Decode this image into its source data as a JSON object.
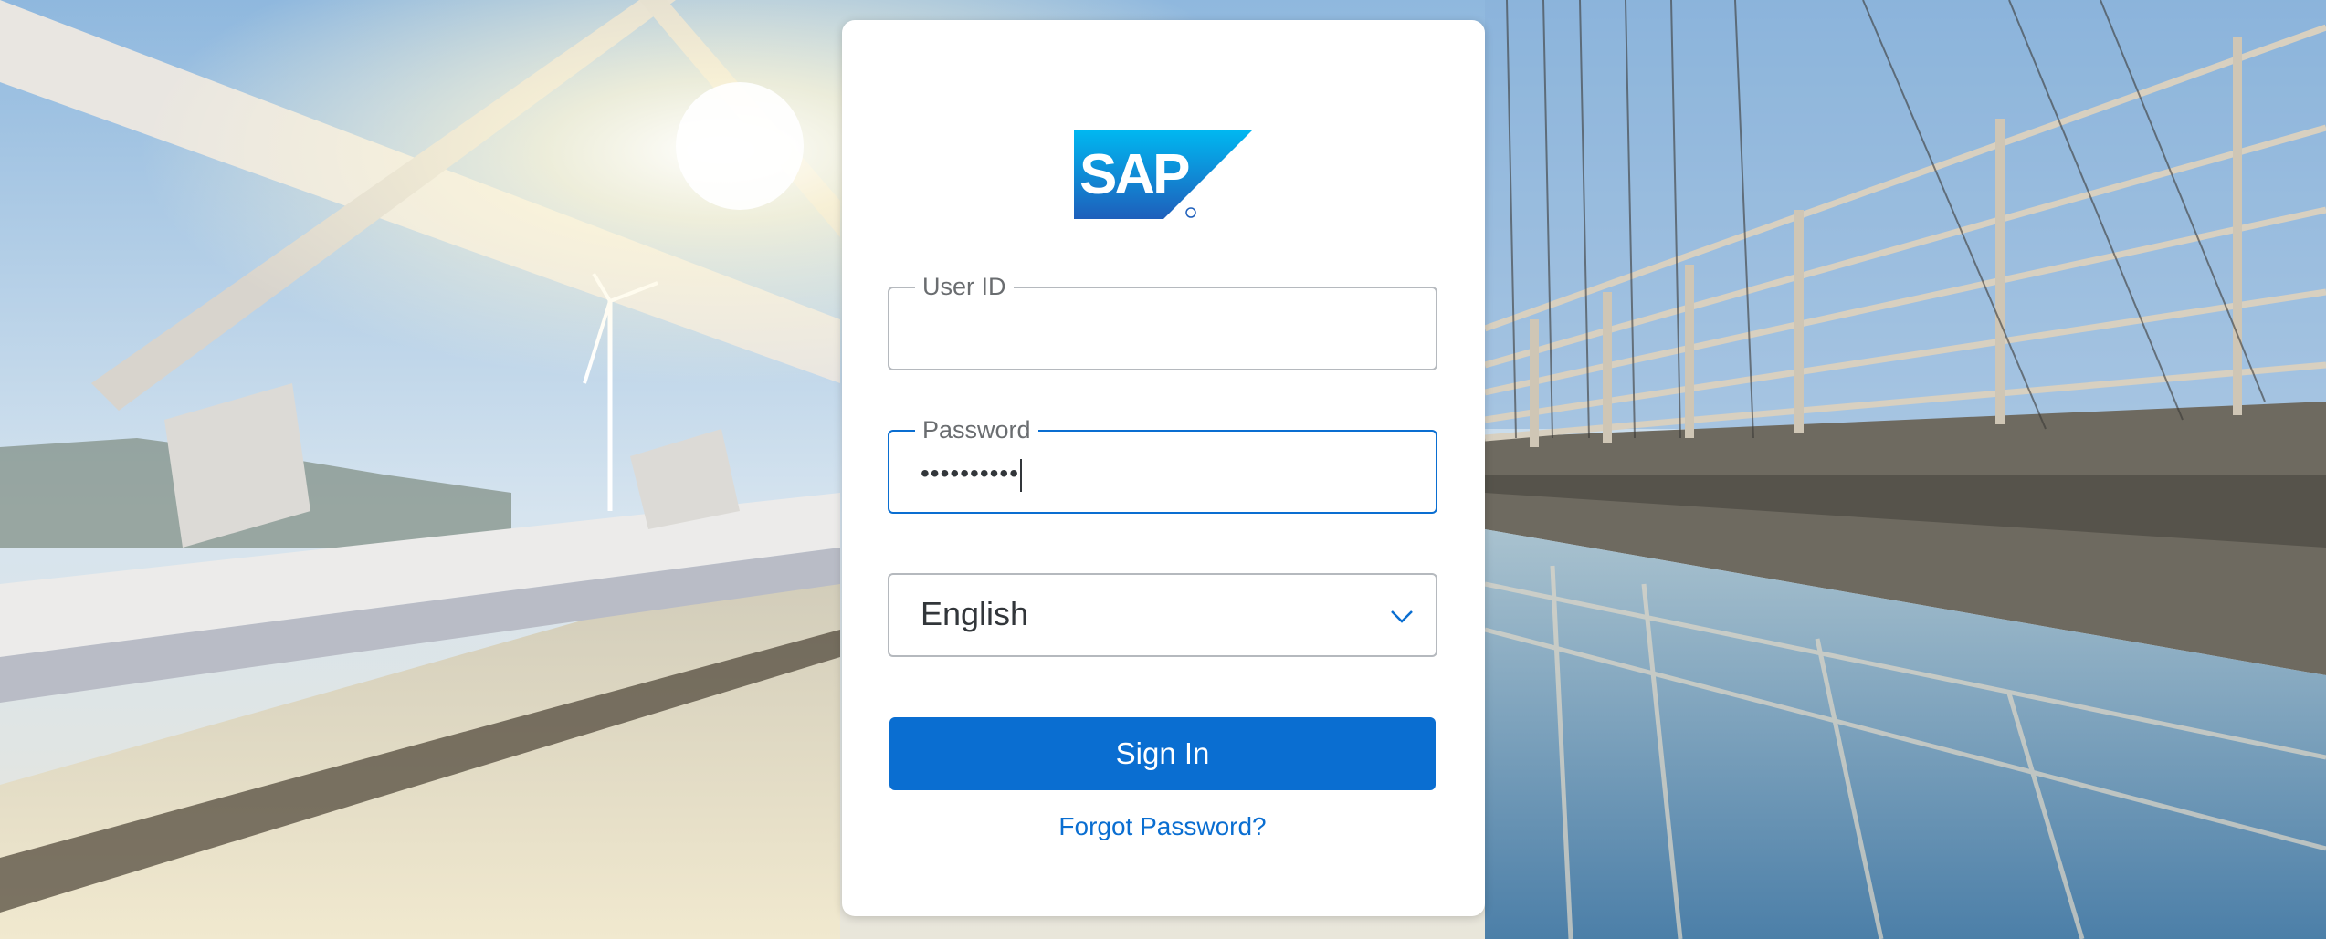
{
  "brand": {
    "logo_text": "SAP",
    "primary_color": "#0a6ed1"
  },
  "login": {
    "user_id": {
      "label": "User ID",
      "value": ""
    },
    "password": {
      "label": "Password",
      "masked_value": "••••••••••"
    },
    "language": {
      "selected": "English",
      "icon": "chevron-down-icon"
    },
    "sign_in_label": "Sign In",
    "forgot_password_label": "Forgot Password?"
  }
}
